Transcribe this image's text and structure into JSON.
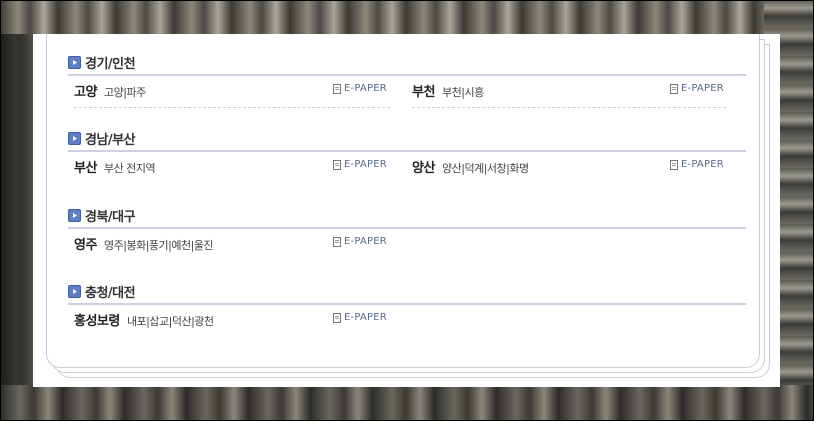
{
  "sections": [
    {
      "title": "경기/인천",
      "left": {
        "name": "고양",
        "areas": "고양|파주",
        "epaper": "E-PAPER"
      },
      "right": {
        "name": "부천",
        "areas": "부천|시흥",
        "epaper": "E-PAPER"
      }
    },
    {
      "title": "경남/부산",
      "left": {
        "name": "부산",
        "areas": "부산 전지역",
        "epaper": "E-PAPER"
      },
      "right": {
        "name": "양산",
        "areas": "양산|덕계|서창|화명",
        "epaper": "E-PAPER"
      }
    },
    {
      "title": "경북/대구",
      "left": {
        "name": "영주",
        "areas": "영주|봉화|풍기|예천|울진",
        "epaper": "E-PAPER"
      }
    },
    {
      "title": "충청/대전",
      "left": {
        "name": "홍성보령",
        "areas": "내포|삽교|덕산|광천",
        "epaper": "E-PAPER"
      }
    }
  ],
  "icons": {
    "section_bullet": "arrow-right-bullet-icon",
    "epaper": "document-icon"
  },
  "colors": {
    "section_bullet": "#5f7fc4",
    "rule": "#cdd0de",
    "epaper_text": "#5a6a8a"
  }
}
